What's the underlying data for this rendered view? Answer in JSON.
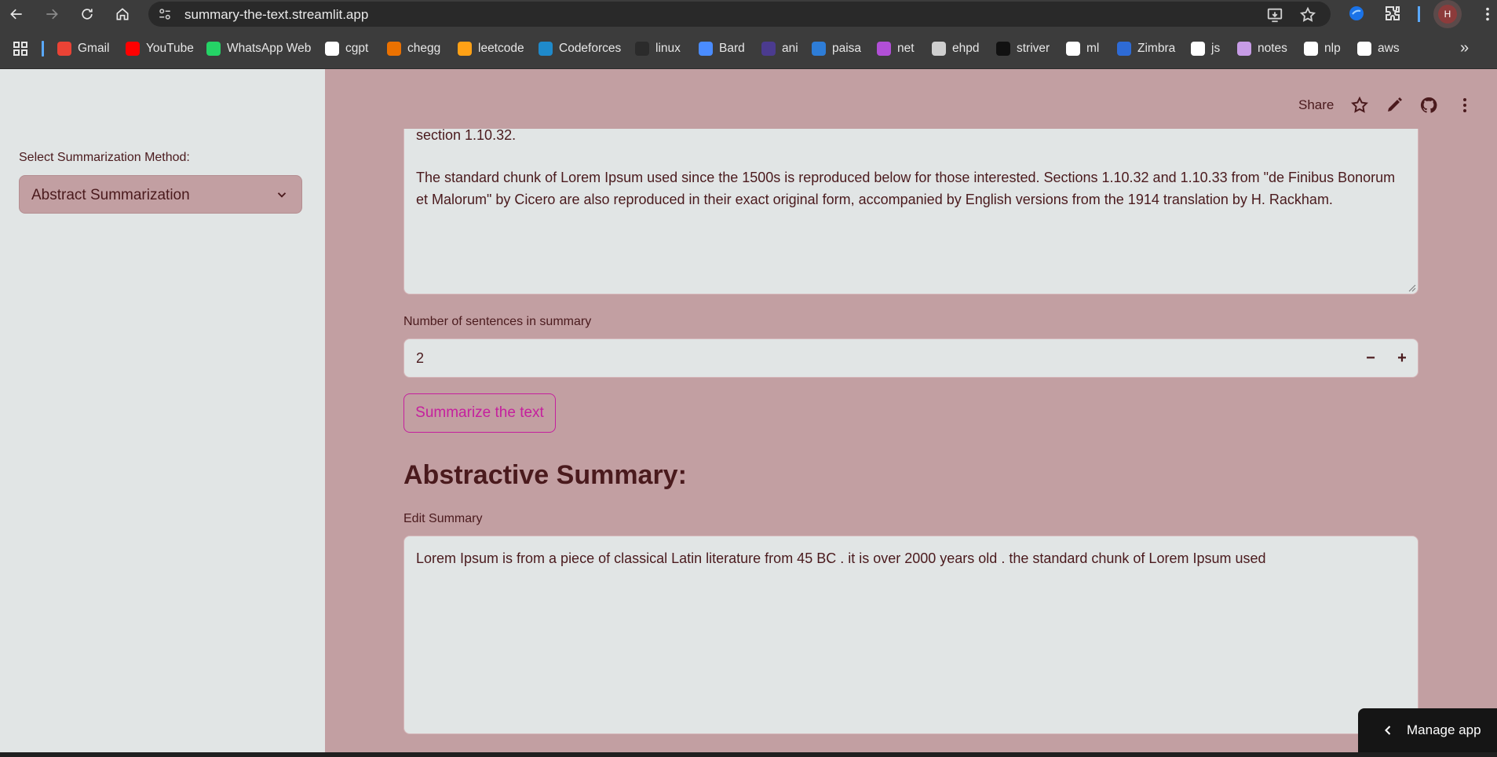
{
  "browser": {
    "url": "summary-the-text.streamlit.app",
    "profile_initial": "H",
    "bookmarks": [
      {
        "label": "Gmail",
        "icon": "gmail-icon",
        "color": "#ea4335"
      },
      {
        "label": "YouTube",
        "icon": "youtube-icon",
        "color": "#ff0000"
      },
      {
        "label": "WhatsApp Web",
        "icon": "whatsapp-icon",
        "color": "#25d366"
      },
      {
        "label": "cgpt",
        "icon": "chatgpt-icon",
        "color": "#ffffff"
      },
      {
        "label": "chegg",
        "icon": "chegg-icon",
        "color": "#eb7100"
      },
      {
        "label": "leetcode",
        "icon": "leetcode-icon",
        "color": "#ffa116"
      },
      {
        "label": "Codeforces",
        "icon": "codeforces-icon",
        "color": "#1f8acb"
      },
      {
        "label": "linux",
        "icon": "github-icon",
        "color": "#2b2b2b"
      },
      {
        "label": "Bard",
        "icon": "bard-icon",
        "color": "#4a8cff"
      },
      {
        "label": "ani",
        "icon": "hianime-icon",
        "color": "#4b3b8f"
      },
      {
        "label": "paisa",
        "icon": "paisa-icon",
        "color": "#2e7dd7"
      },
      {
        "label": "net",
        "icon": "umbrella-icon",
        "color": "#b14fd6"
      },
      {
        "label": "ehpd",
        "icon": "ehpd-icon",
        "color": "#cfcfcf"
      },
      {
        "label": "striver",
        "icon": "tuf-icon",
        "color": "#111111"
      },
      {
        "label": "ml",
        "icon": "github-icon",
        "color": "#ffffff"
      },
      {
        "label": "Zimbra",
        "icon": "zimbra-icon",
        "color": "#2e6bd6"
      },
      {
        "label": "js",
        "icon": "github-icon",
        "color": "#ffffff"
      },
      {
        "label": "notes",
        "icon": "notes-icon",
        "color": "#c79ce6"
      },
      {
        "label": "nlp",
        "icon": "github-icon",
        "color": "#ffffff"
      },
      {
        "label": "aws",
        "icon": "github-icon",
        "color": "#ffffff"
      }
    ]
  },
  "sidebar": {
    "method_label": "Select Summarization Method:",
    "method_value": "Abstract Summarization"
  },
  "header": {
    "share_label": "Share"
  },
  "input_text": {
    "line_partial": "section 1.10.32.",
    "paragraph": "The standard chunk of Lorem Ipsum used since the 1500s is reproduced below for those interested. Sections 1.10.32 and 1.10.33 from \"de Finibus Bonorum et Malorum\" by Cicero are also reproduced in their exact original form, accompanied by English versions from the 1914 translation by H. Rackham."
  },
  "sentences": {
    "label": "Number of sentences in summary",
    "value": "2",
    "minus": "−",
    "plus": "+"
  },
  "summarize_button": "Summarize the text",
  "summary": {
    "heading": "Abstractive Summary:",
    "edit_label": "Edit Summary",
    "text": "Lorem Ipsum is from a piece of classical Latin literature from 45 BC . it is over 2000 years old . the standard chunk of Lorem Ipsum used"
  },
  "manage_app": "Manage app",
  "colors": {
    "accent": "#c5209e",
    "main_bg": "#c29fa2",
    "sidebar_bg": "#e1e5e5",
    "text": "#4a1a1d"
  }
}
